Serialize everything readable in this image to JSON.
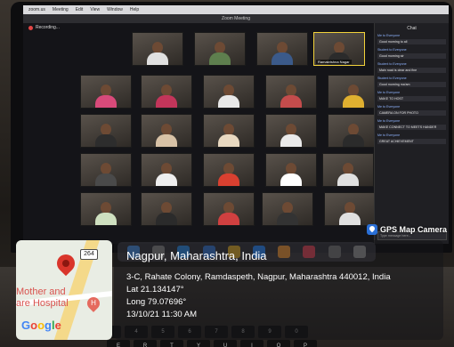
{
  "menubar": {
    "items": [
      "zoom.us",
      "Meeting",
      "Edit",
      "View",
      "Window",
      "Help"
    ]
  },
  "window": {
    "title": "Zoom Meeting",
    "recording_label": "Recording..."
  },
  "gallery": {
    "tiles": [
      {
        "shirt": "#e0e0e0"
      },
      {
        "shirt": "#5e7f4e"
      },
      {
        "shirt": "#3b5a8a"
      },
      {
        "shirt": "#2b2b2b",
        "name": "Ramakrishna Nagar",
        "active": true
      },
      {
        "shirt": "#d94a7a"
      },
      {
        "shirt": "#c3355a"
      },
      {
        "shirt": "#e8e8e8"
      },
      {
        "shirt": "#c44c4c"
      },
      {
        "shirt": "#e0b030"
      },
      {
        "shirt": "#2d2d2d"
      },
      {
        "shirt": "#d8c2a6"
      },
      {
        "shirt": "#e8d8c0"
      },
      {
        "shirt": "#eaeaea"
      },
      {
        "shirt": "#2b2b2b"
      },
      {
        "shirt": "#4a4a4a"
      },
      {
        "shirt": "#eeeeee"
      },
      {
        "shirt": "#d94030"
      },
      {
        "shirt": "#ffffff"
      },
      {
        "shirt": "#e0e0e0"
      },
      {
        "shirt": "#cfe0c0"
      },
      {
        "shirt": "#2b2b2b"
      },
      {
        "shirt": "#d04040"
      },
      {
        "shirt": "#333333"
      },
      {
        "shirt": "#e0e0e0"
      }
    ]
  },
  "chat": {
    "title": "Chat",
    "messages": [
      {
        "who": "Me to Everyone",
        "text": "Good morning to all"
      },
      {
        "who": "Student to Everyone",
        "text": "Good morning sir"
      },
      {
        "who": "Student to Everyone",
        "text": "Main road is clear and fine"
      },
      {
        "who": "Student to Everyone",
        "text": "Good morning ma'am"
      },
      {
        "who": "Me to Everyone",
        "text": "MAKE TO HOST"
      },
      {
        "who": "Me to Everyone",
        "text": "CAMERA ON FOR PHOTO"
      },
      {
        "who": "Me to Everyone",
        "text": "MAKE CONNECT TO MEETS HANDER"
      },
      {
        "who": "Me to Everyone",
        "text": "GREAT ACHIEVEMENT"
      }
    ],
    "input_placeholder": "Type message here..."
  },
  "dock": {
    "icons": [
      {
        "name": "finder-icon",
        "color": "#4a90e2"
      },
      {
        "name": "launchpad-icon",
        "color": "#8a8a8a"
      },
      {
        "name": "safari-icon",
        "color": "#2f8fe8"
      },
      {
        "name": "mail-icon",
        "color": "#3a7bd5"
      },
      {
        "name": "chrome-icon",
        "color": "#e2b02e"
      },
      {
        "name": "zoom-icon",
        "color": "#2d8cff"
      },
      {
        "name": "photos-icon",
        "color": "#f29a3a"
      },
      {
        "name": "music-icon",
        "color": "#e64a5c"
      },
      {
        "name": "settings-icon",
        "color": "#7b7b7b"
      },
      {
        "name": "trash-icon",
        "color": "#9a9a9a"
      }
    ]
  },
  "keyboard": {
    "row1": [
      "3",
      "4",
      "5",
      "6",
      "7",
      "8",
      "9",
      "0"
    ],
    "row2": [
      "E",
      "R",
      "T",
      "Y",
      "U",
      "I",
      "O",
      "P"
    ]
  },
  "gps": {
    "app_name": "GPS Map Camera",
    "city": "Nagpur, Maharashtra, India",
    "address": "3-C, Rahate Colony, Ramdaspeth, Nagpur, Maharashtra 440012, India",
    "lat": "Lat 21.134147°",
    "long": "Long 79.07696°",
    "datetime": "13/10/21 11:30 AM",
    "map": {
      "route_number": "264",
      "place_line1": "Mother and",
      "place_line2": "are Hospital",
      "hospital_glyph": "H",
      "google": [
        "G",
        "o",
        "o",
        "g",
        "l",
        "e"
      ],
      "google_colors": [
        "#4285f4",
        "#ea4335",
        "#fbbc05",
        "#4285f4",
        "#34a853",
        "#ea4335"
      ]
    }
  }
}
